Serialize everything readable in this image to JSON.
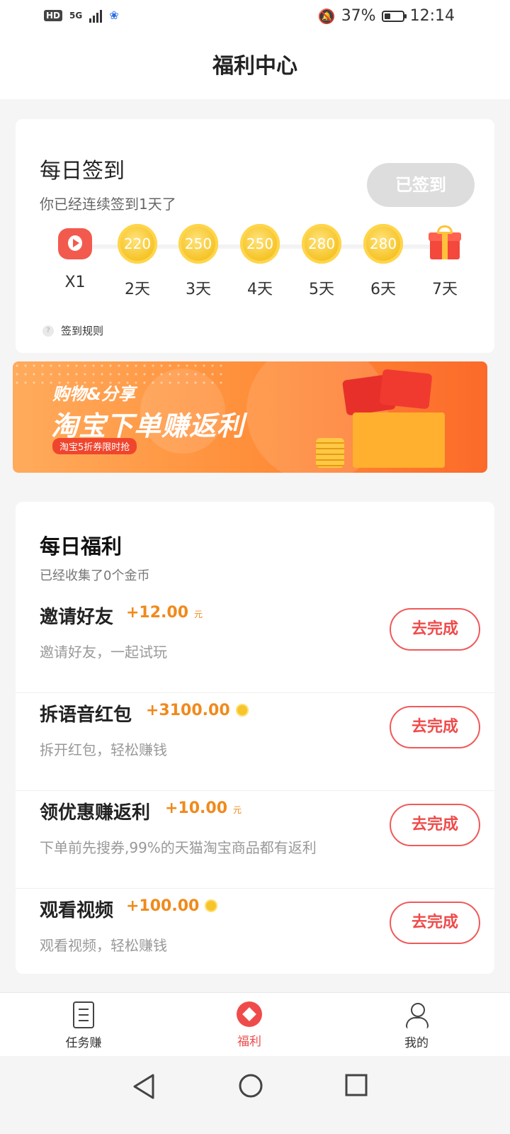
{
  "status_bar": {
    "hd": "HD",
    "network": "5G",
    "battery": "37%",
    "battery_level": 0.37,
    "time": "12:14",
    "icons": [
      "signal-icon",
      "baidu-icon",
      "mute-bell-icon",
      "battery-icon"
    ]
  },
  "header": {
    "title": "福利中心"
  },
  "signin": {
    "title": "每日签到",
    "subtitle": "你已经连续签到1天了",
    "button_label": "已签到",
    "days": [
      {
        "label": "X1",
        "icon": "play-icon"
      },
      {
        "label": "2天",
        "coin": "220"
      },
      {
        "label": "3天",
        "coin": "250"
      },
      {
        "label": "4天",
        "coin": "250"
      },
      {
        "label": "5天",
        "coin": "280"
      },
      {
        "label": "6天",
        "coin": "280"
      },
      {
        "label": "7天",
        "icon": "gift-icon"
      }
    ],
    "rules": "签到规则"
  },
  "banner": {
    "line1": "购物&分享",
    "line2": "淘宝下单赚返利",
    "pill": "淘宝5折券限时抢"
  },
  "tasks": {
    "title": "每日福利",
    "subtitle": "已经收集了0个金币",
    "items": [
      {
        "name": "邀请好友",
        "reward": "+12.00",
        "unit": "元",
        "desc": "邀请好友，一起试玩",
        "button": "去完成"
      },
      {
        "name": "拆语音红包",
        "reward": "+3100.00",
        "coin_icon": true,
        "desc": "拆开红包，轻松赚钱",
        "button": "去完成"
      },
      {
        "name": "领优惠赚返利",
        "reward": "+10.00",
        "unit": "元",
        "desc": "下单前先搜券,99%的天猫淘宝商品都有返利",
        "button": "去完成"
      },
      {
        "name": "观看视频",
        "reward": "+100.00",
        "coin_icon": true,
        "desc": "观看视频，轻松赚钱",
        "button": "去完成"
      }
    ]
  },
  "tabbar": {
    "items": [
      {
        "label": "任务赚"
      },
      {
        "label": "福利"
      },
      {
        "label": "我的"
      }
    ],
    "active_color": "#ef4b4b"
  }
}
